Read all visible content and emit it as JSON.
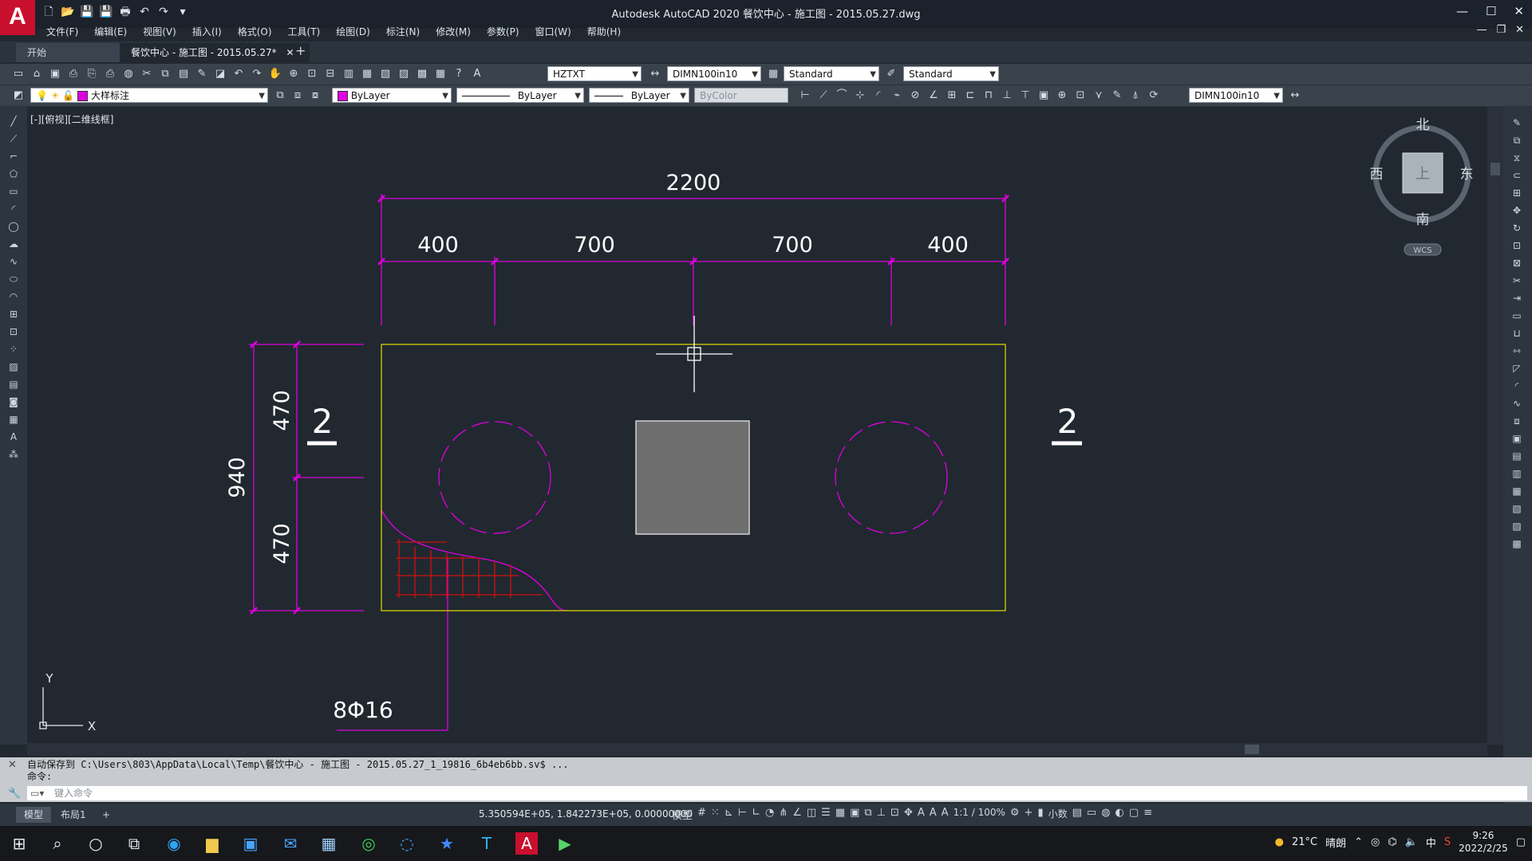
{
  "app": {
    "logo_letter": "A",
    "window_title": "Autodesk AutoCAD 2020    餐饮中心 - 施工图 - 2015.05.27.dwg",
    "window_controls": [
      "—",
      "☐",
      "✕"
    ],
    "doc_controls": [
      "—",
      "❐",
      "✕"
    ]
  },
  "quick_access": [
    "🗋",
    "📂",
    "💾",
    "💾",
    "🖶",
    "↶",
    "↷",
    "▾"
  ],
  "menu": [
    "文件(F)",
    "编辑(E)",
    "视图(V)",
    "插入(I)",
    "格式(O)",
    "工具(T)",
    "绘图(D)",
    "标注(N)",
    "修改(M)",
    "参数(P)",
    "窗口(W)",
    "帮助(H)"
  ],
  "tabs": {
    "start": "开始",
    "drawing": "餐饮中心 - 施工图 - 2015.05.27*",
    "close": "✕",
    "add": "+"
  },
  "toolbar1": {
    "text_style": "HZTXT",
    "dim_style": "DIMN100in10",
    "table_style": "Standard",
    "multileader_style": "Standard"
  },
  "toolbar2": {
    "layer": "大样标注",
    "layer_color": "#e000e0",
    "color": "ByLayer",
    "linetype": "ByLayer",
    "lineweight": "ByLayer",
    "plotstyle": "ByColor",
    "dim_style": "DIMN100in10"
  },
  "viewport_label": "[-][俯视][二维线框]",
  "viewcube": {
    "north": "北",
    "south": "南",
    "east": "东",
    "west": "西",
    "face": "上",
    "wcs": "WCS"
  },
  "drawing": {
    "overall_dim": "2200",
    "segment_dims": [
      "400",
      "700",
      "700",
      "400"
    ],
    "left_overall_dim": "940",
    "left_segment_dims": [
      "470",
      "470"
    ],
    "section_mark": "2",
    "rebar_label": "8Φ16",
    "ucs_x": "X",
    "ucs_y": "Y",
    "colors": {
      "dimension": "#e000e0",
      "outline": "#d8d000",
      "hatch": "#d01010",
      "column": "#6e6e6e"
    }
  },
  "command": {
    "history_1": "自动保存到 C:\\Users\\803\\AppData\\Local\\Temp\\餐饮中心 - 施工图 - 2015.05.27_1_19816_6b4eb6bb.sv$ ...",
    "history_2": "命令:",
    "placeholder": "键入命令"
  },
  "layout_tabs": [
    "模型",
    "布局1",
    "+"
  ],
  "status": {
    "coords": "5.350594E+05, 1.842273E+05, 0.00000000",
    "model": "模型",
    "scale": "1:1 / 100%",
    "units": "小数"
  },
  "taskbar": {
    "weather_temp": "21°C",
    "weather_text": "晴朗",
    "ime": "中",
    "time": "9:26",
    "date": "2022/2/25"
  }
}
